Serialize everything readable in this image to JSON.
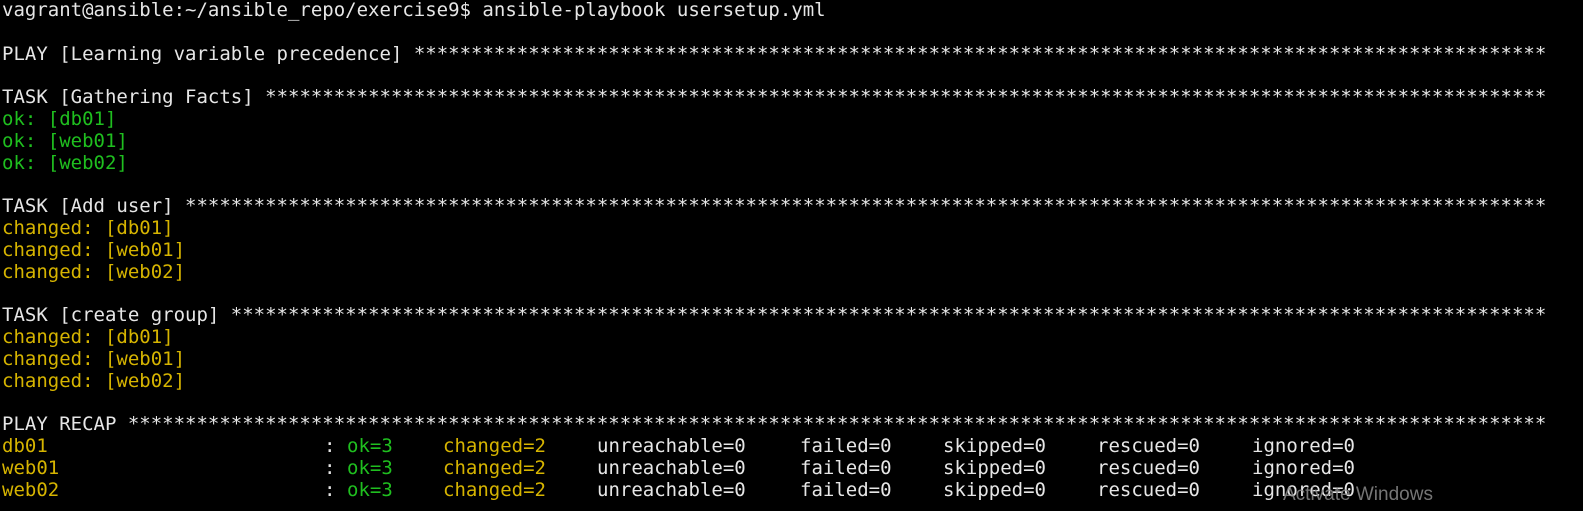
{
  "prompt": "vagrant@ansible:~/ansible_repo/exercise9$ ansible-playbook usersetup.yml",
  "star_char": "*",
  "play_header": "PLAY [Learning variable precedence]",
  "tasks": [
    {
      "header": "TASK [Gathering Facts]",
      "results": [
        {
          "status": "ok:",
          "host": "[db01]"
        },
        {
          "status": "ok:",
          "host": "[web01]"
        },
        {
          "status": "ok:",
          "host": "[web02]"
        }
      ]
    },
    {
      "header": "TASK [Add user]",
      "results": [
        {
          "status": "changed:",
          "host": "[db01]"
        },
        {
          "status": "changed:",
          "host": "[web01]"
        },
        {
          "status": "changed:",
          "host": "[web02]"
        }
      ]
    },
    {
      "header": "TASK [create group]",
      "results": [
        {
          "status": "changed:",
          "host": "[db01]"
        },
        {
          "status": "changed:",
          "host": "[web01]"
        },
        {
          "status": "changed:",
          "host": "[web02]"
        }
      ]
    }
  ],
  "recap_header": "PLAY RECAP",
  "recap": [
    {
      "host": "db01",
      "sep": ":",
      "ok": "ok=3",
      "changed": "changed=2",
      "unreachable": "unreachable=0",
      "failed": "failed=0",
      "skipped": "skipped=0",
      "rescued": "rescued=0",
      "ignored": "ignored=0"
    },
    {
      "host": "web01",
      "sep": ":",
      "ok": "ok=3",
      "changed": "changed=2",
      "unreachable": "unreachable=0",
      "failed": "failed=0",
      "skipped": "skipped=0",
      "rescued": "rescued=0",
      "ignored": "ignored=0"
    },
    {
      "host": "web02",
      "sep": ":",
      "ok": "ok=3",
      "changed": "changed=2",
      "unreachable": "unreachable=0",
      "failed": "failed=0",
      "skipped": "skipped=0",
      "rescued": "rescued=0",
      "ignored": "ignored=0"
    }
  ],
  "watermark": "Activate Windows",
  "colors": {
    "background": "#000000",
    "text": "#e6e6e6",
    "ok": "#1fbf1f",
    "changed": "#d6b400"
  }
}
